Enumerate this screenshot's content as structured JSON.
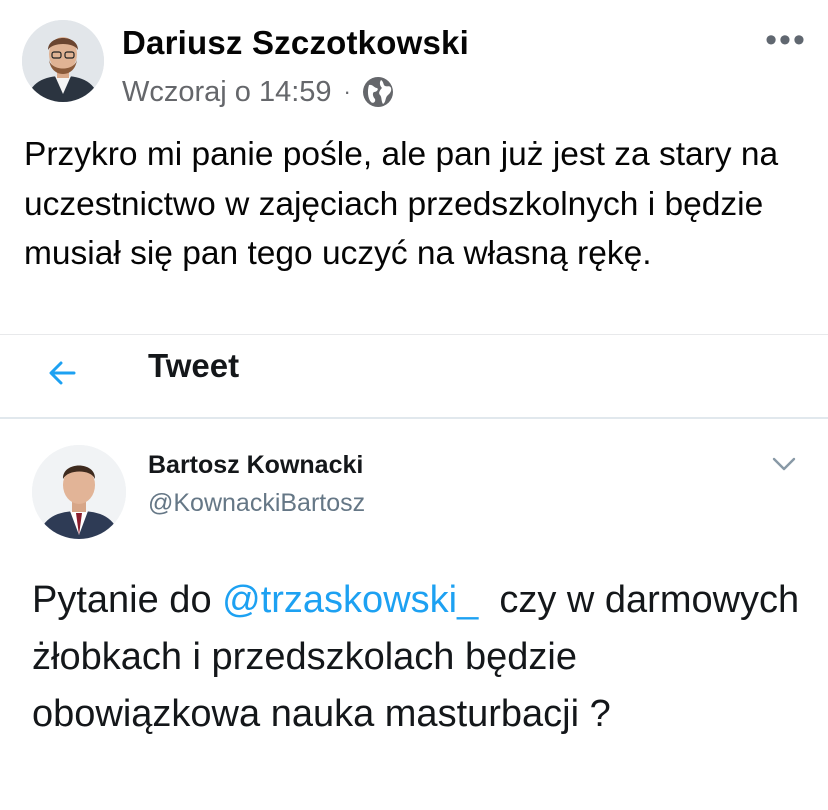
{
  "facebook_post": {
    "author_name": "Dariusz Szczotkowski",
    "timestamp": "Wczoraj o 14:59",
    "separator": "·",
    "privacy_icon": "globe-icon",
    "more_label": "•••",
    "text": "Przykro mi panie pośle, ale pan już jest za stary na uczestnictwo w zajęciach przedszkolnych i będzie musiał się pan tego uczyć na własną rękę."
  },
  "tweet": {
    "header_title": "Tweet",
    "back_icon": "back-arrow-icon",
    "author_name": "Bartosz Kownacki",
    "author_handle": "@KownackiBartosz",
    "menu_icon": "chevron-down-icon",
    "text_before": "Pytanie do ",
    "mention": "@trzaskowski_",
    "text_after": "  czy w darmowych żłobkach i przedszkolach będzie obowiązkowa nauka masturbacji ?"
  },
  "colors": {
    "twitter_blue": "#1da1f2",
    "fb_secondary_text": "#65676b",
    "twitter_secondary_text": "#657786"
  }
}
